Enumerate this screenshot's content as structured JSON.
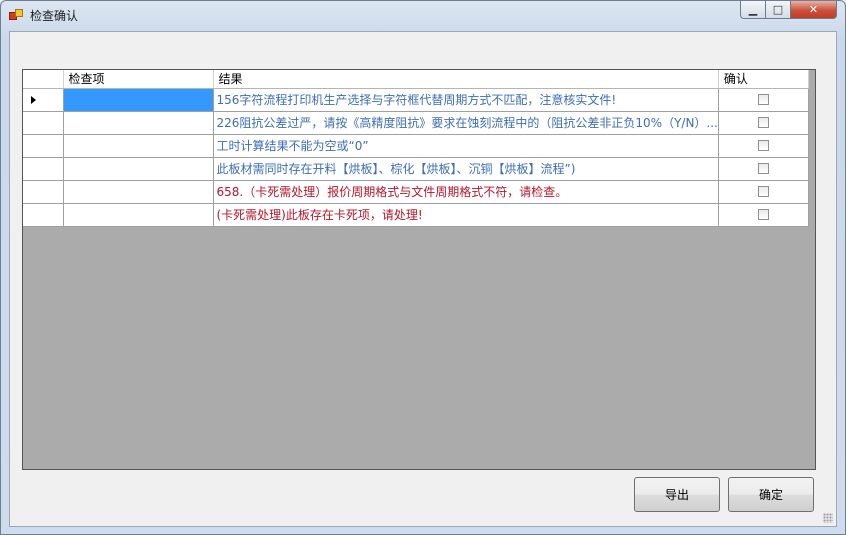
{
  "window": {
    "title": "检查确认",
    "minimize_glyph": "▁",
    "maximize_glyph": "□",
    "close_glyph": "✕"
  },
  "grid": {
    "columns": [
      "检查项",
      "结果",
      "确认"
    ],
    "rows": [
      {
        "item": "",
        "result": "156字符流程打印机生产选择与字符框代替周期方式不匹配，注意核实文件!",
        "color": "#3c6eb4",
        "checked": false,
        "selected": true
      },
      {
        "item": "",
        "result": "226阻抗公差过严，请按《高精度阻抗》要求在蚀刻流程中的（阻抗公差非正负10%（Y/N）...",
        "color": "#3c6eb4",
        "checked": false,
        "selected": false
      },
      {
        "item": "",
        "result": "工时计算结果不能为空或“0”",
        "color": "#3c6eb4",
        "checked": false,
        "selected": false
      },
      {
        "item": "",
        "result": "此板材需同时存在开料【烘板】、棕化【烘板】、沉铜【烘板】流程”)",
        "color": "#3c6eb4",
        "checked": false,
        "selected": false
      },
      {
        "item": "",
        "result": "658.（卡死需处理）报价周期格式与文件周期格式不符，请检查。",
        "color": "#b5162a",
        "checked": false,
        "selected": false
      },
      {
        "item": "",
        "result": "(卡死需处理)此板存在卡死项，请处理!",
        "color": "#b5162a",
        "checked": false,
        "selected": false
      }
    ]
  },
  "buttons": {
    "export_label": "导出",
    "ok_label": "确定"
  }
}
